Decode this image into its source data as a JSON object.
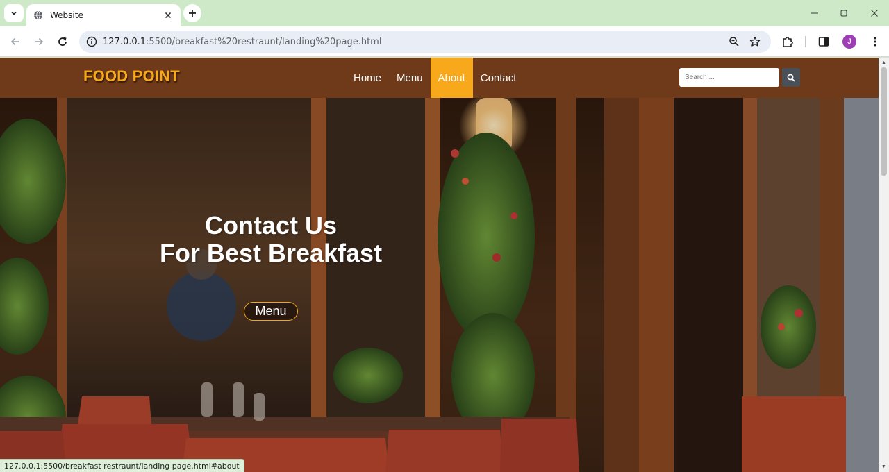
{
  "browser": {
    "tab_title": "Website",
    "url_host": "127.0.0.1",
    "url_path": ":5500/breakfast%20restraunt/landing%20page.html",
    "profile_initial": "J",
    "status_url": "127.0.0.1:5500/breakfast restraunt/landing page.html#about",
    "icons": {
      "tab_search": "chevron-down-icon",
      "tab_favicon": "globe-icon",
      "tab_close": "close-icon",
      "new_tab": "plus-icon",
      "back": "arrow-left-icon",
      "forward": "arrow-right-icon",
      "reload": "reload-icon",
      "site_info": "info-icon",
      "zoom": "zoom-icon",
      "bookmark": "star-icon",
      "extensions": "puzzle-icon",
      "side_panel": "side-panel-icon",
      "menu": "kebab-menu-icon",
      "minimize": "minimize-icon",
      "maximize": "maximize-icon",
      "close_window": "close-icon"
    }
  },
  "site": {
    "logo": "FOOD POINT",
    "nav": [
      {
        "label": "Home",
        "active": false
      },
      {
        "label": "Menu",
        "active": false
      },
      {
        "label": "About",
        "active": true
      },
      {
        "label": "Contact",
        "active": false
      }
    ],
    "search_placeholder": "Search ...",
    "hero": {
      "title_line1": "Contact Us",
      "title_line2": "For Best Breakfast",
      "button": "Menu"
    },
    "colors": {
      "nav_bg": "#6e3a1a",
      "accent": "#f7a81b",
      "search_button": "#4a5058"
    }
  }
}
